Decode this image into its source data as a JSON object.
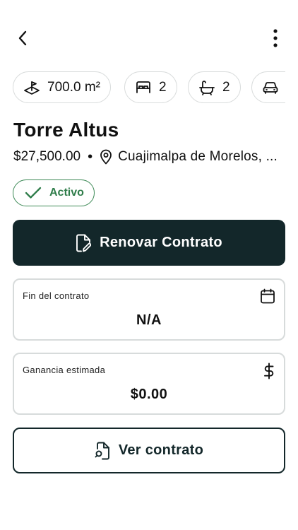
{
  "header": {
    "back_icon": "chevron-left-icon",
    "menu_icon": "more-vertical-icon"
  },
  "features": [
    {
      "icon": "land-area-icon",
      "value": "700.0 m²"
    },
    {
      "icon": "bed-icon",
      "value": "2"
    },
    {
      "icon": "bathtub-icon",
      "value": "2"
    },
    {
      "icon": "car-icon",
      "value": ""
    }
  ],
  "property": {
    "name": "Torre Altus",
    "price": "$27,500.00",
    "separator": "•",
    "location": "Cuajimalpa de Morelos, ...",
    "status": "Activo",
    "status_color": "#2f7d4a"
  },
  "actions": {
    "renew_label": "Renovar Contrato",
    "view_label": "Ver contrato"
  },
  "cards": {
    "contract_end": {
      "label": "Fin del contrato",
      "value": "N/A",
      "icon": "calendar-icon"
    },
    "estimated_gain": {
      "label": "Ganancia estimada",
      "value": "$0.00",
      "icon": "dollar-icon"
    }
  },
  "colors": {
    "primary": "#13272a",
    "chip_border": "#d9dcdc",
    "card_border": "#d7dbdb"
  }
}
